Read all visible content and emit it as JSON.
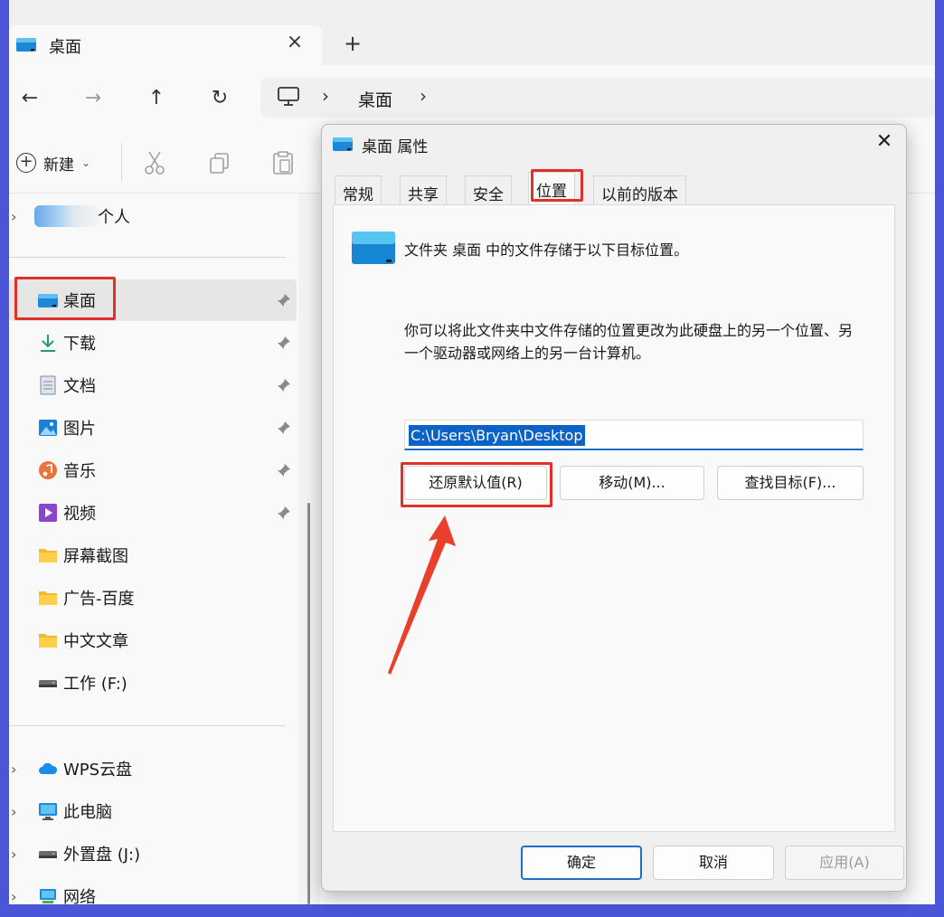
{
  "window": {
    "tab_title": "桌面",
    "tab_close": "×",
    "new_tab": "+"
  },
  "nav": {
    "back": "←",
    "forward": "→",
    "up": "↑",
    "refresh": "↻",
    "chevron": "›",
    "breadcrumb": "桌面"
  },
  "toolbar": {
    "new_label": "新建",
    "new_caret": "⌄"
  },
  "sidebar": {
    "personal": "个人",
    "items": [
      {
        "label": "桌面",
        "icon": "desktop-folder-icon",
        "pinned": true
      },
      {
        "label": "下载",
        "icon": "download-icon",
        "pinned": true
      },
      {
        "label": "文档",
        "icon": "document-icon",
        "pinned": true
      },
      {
        "label": "图片",
        "icon": "picture-icon",
        "pinned": true
      },
      {
        "label": "音乐",
        "icon": "music-icon",
        "pinned": true
      },
      {
        "label": "视频",
        "icon": "video-icon",
        "pinned": true
      },
      {
        "label": "屏幕截图",
        "icon": "folder-icon",
        "pinned": false
      },
      {
        "label": "广告-百度",
        "icon": "folder-icon",
        "pinned": false
      },
      {
        "label": "中文文章",
        "icon": "folder-icon",
        "pinned": false
      },
      {
        "label": "工作 (F:)",
        "icon": "drive-icon",
        "pinned": false
      }
    ],
    "bottom_items": [
      {
        "label": "WPS云盘",
        "icon": "cloud-icon"
      },
      {
        "label": "此电脑",
        "icon": "computer-icon"
      },
      {
        "label": "外置盘 (J:)",
        "icon": "drive-icon"
      },
      {
        "label": "网络",
        "icon": "network-icon"
      }
    ]
  },
  "dialog": {
    "title": "桌面 属性",
    "close": "✕",
    "tabs": [
      "常规",
      "共享",
      "安全",
      "位置",
      "以前的版本"
    ],
    "active_tab": "位置",
    "description": "文件夹 桌面 中的文件存储于以下目标位置。",
    "hint": "你可以将此文件夹中文件存储的位置更改为此硬盘上的另一个位置、另一个驱动器或网络上的另一台计算机。",
    "path_value": "C:\\Users\\Bryan\\Desktop",
    "restore_button": "还原默认值(R)",
    "move_button": "移动(M)...",
    "find_button": "查找目标(F)...",
    "ok_button": "确定",
    "cancel_button": "取消",
    "apply_button": "应用(A)"
  },
  "colors": {
    "border_frame": "#4a55d8",
    "highlight_red": "#e0302a",
    "accent_blue": "#1f6fc5",
    "selection_blue": "#0b63c8"
  }
}
